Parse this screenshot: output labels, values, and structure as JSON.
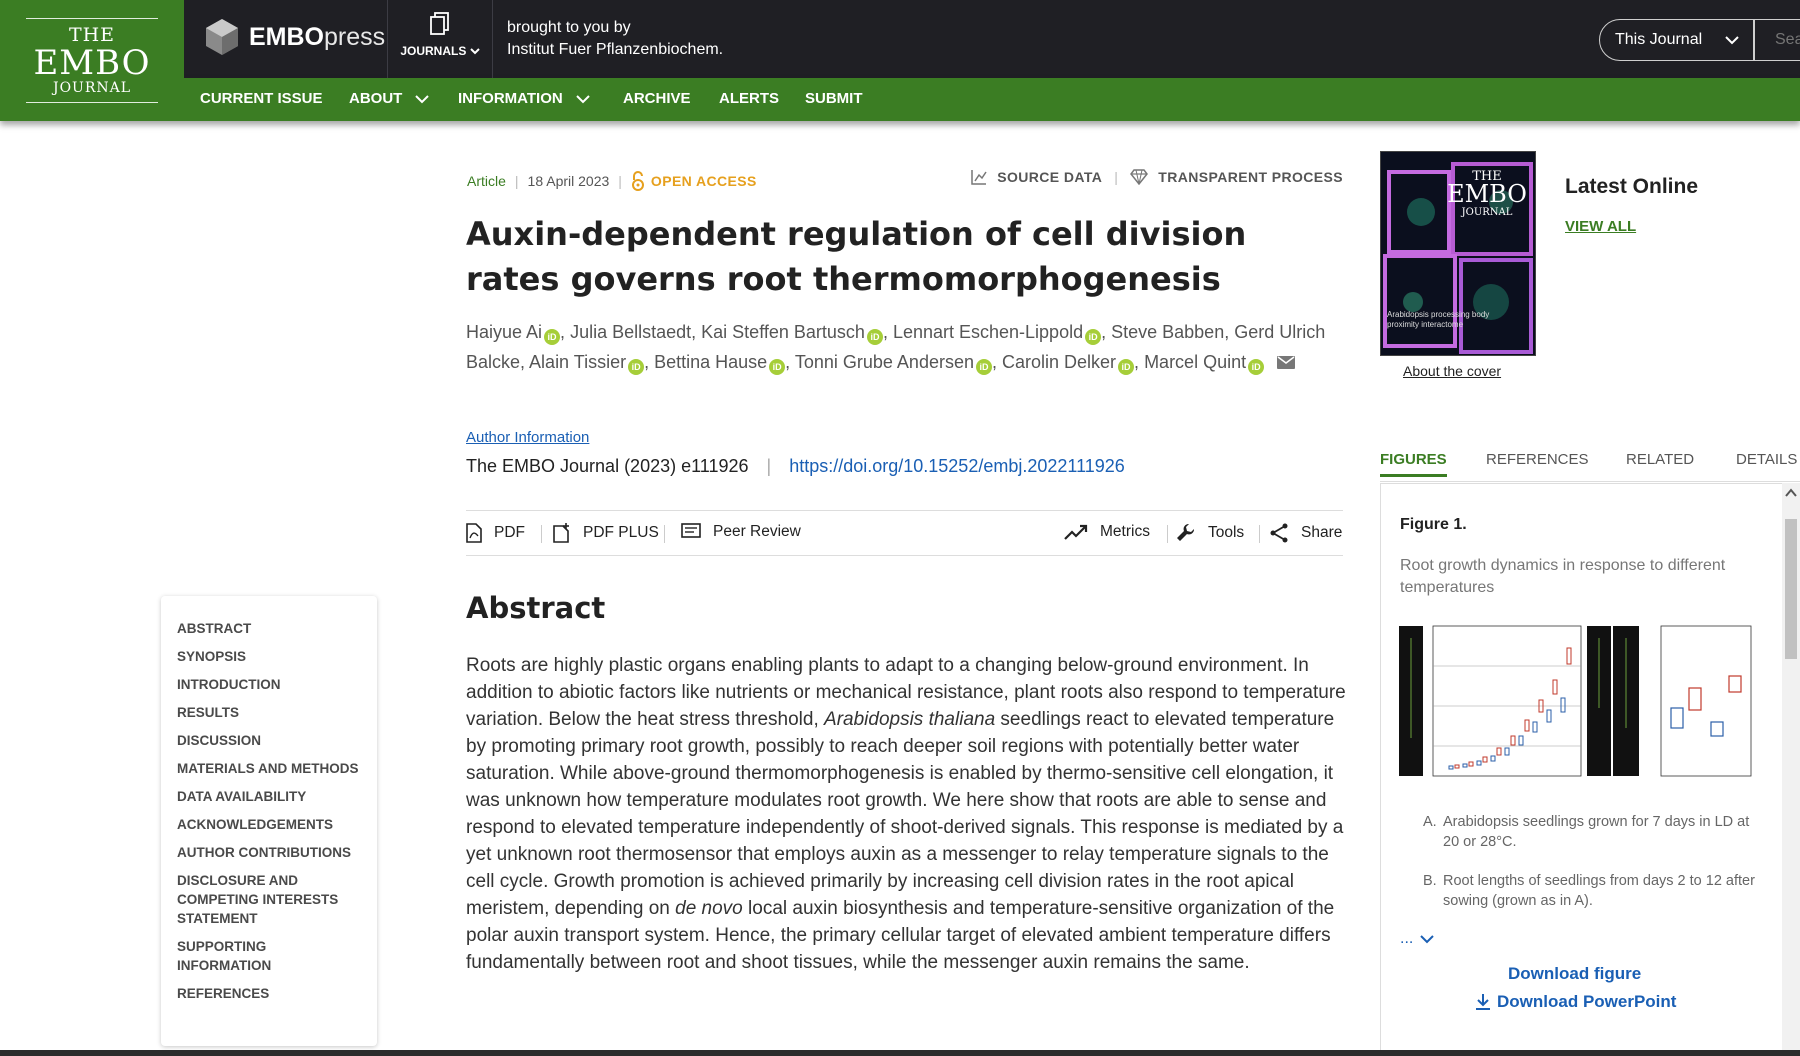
{
  "header": {
    "logo": {
      "line1": "THE",
      "line2": "EMBO",
      "line3": "JOURNAL"
    },
    "embopress": {
      "bold": "EMBO",
      "light": "press"
    },
    "journals_label": "JOURNALS",
    "brought_line1": "brought to you by",
    "brought_line2": "Institut Fuer Pflanzenbiochem.",
    "journal_select": "This Journal",
    "search_placeholder": "Sea"
  },
  "nav": {
    "items": [
      "CURRENT ISSUE",
      "ABOUT",
      "INFORMATION",
      "ARCHIVE",
      "ALERTS",
      "SUBMIT"
    ]
  },
  "toc": {
    "items": [
      "ABSTRACT",
      "SYNOPSIS",
      "INTRODUCTION",
      "RESULTS",
      "DISCUSSION",
      "MATERIALS AND METHODS",
      "DATA AVAILABILITY",
      "ACKNOWLEDGEMENTS",
      "AUTHOR CONTRIBUTIONS",
      "DISCLOSURE AND COMPETING INTERESTS STATEMENT",
      "SUPPORTING INFORMATION",
      "REFERENCES"
    ]
  },
  "article": {
    "type": "Article",
    "date": "18 April 2023",
    "open_access": "OPEN ACCESS",
    "source_data": "SOURCE DATA",
    "transparent_process": "TRANSPARENT PROCESS",
    "title": "Auxin-dependent regulation of cell division rates governs root thermomorphogenesis",
    "authors": {
      "a1": "Haiyue Ai",
      "a2": "Julia Bellstaedt",
      "a3": "Kai Steffen Bartusch",
      "a4": "Lennart Eschen-Lippold",
      "a5": "Steve Babben",
      "a6": "Gerd Ulrich Balcke",
      "a7": "Alain Tissier",
      "a8": "Bettina Hause",
      "a9": "Tonni Grube Andersen",
      "a10": "Carolin Delker",
      "a11": "Marcel Quint"
    },
    "author_information": "Author Information",
    "citation": "The EMBO Journal (2023) e111926",
    "doi": "https://doi.org/10.15252/embj.2022111926"
  },
  "toolbar": {
    "pdf": "PDF",
    "pdf_plus": "PDF PLUS",
    "peer_review": "Peer Review",
    "metrics": "Metrics",
    "tools": "Tools",
    "share": "Share"
  },
  "abstract": {
    "heading": "Abstract",
    "p1": "Roots are highly plastic organs enabling plants to adapt to a changing below-ground environment. In addition to abiotic factors like nutrients or mechanical resistance, plant roots also respond to temperature variation. Below the heat stress threshold, ",
    "p1_italic": "Arabidopsis thaliana",
    "p2": " seedlings react to elevated temperature by promoting primary root growth, possibly to reach deeper soil regions with potentially better water saturation. While above-ground thermomorphogenesis is enabled by thermo-sensitive cell elongation, it was unknown how temperature modulates root growth. We here show that roots are able to sense and respond to elevated temperature independently of shoot-derived signals. This response is mediated by a yet unknown root thermosensor that employs auxin as a messenger to relay temperature signals to the cell cycle. Growth promotion is achieved primarily by increasing cell division rates in the root apical meristem, depending on ",
    "p2_italic": "de novo",
    "p3": " local auxin biosynthesis and temperature-sensitive organization of the polar auxin transport system. Hence, the primary cellular target of elevated ambient temperature differs fundamentally between root and shoot tissues, while the messenger auxin remains the same."
  },
  "sidebar": {
    "cover_title_1": "THE",
    "cover_title_2": "EMBO",
    "cover_title_3": "JOURNAL",
    "cover_text": "Arabidopsis processing body proximity interactome",
    "about_cover": "About the cover",
    "latest_online": "Latest Online",
    "view_all": "VIEW ALL",
    "tabs": [
      "FIGURES",
      "REFERENCES",
      "RELATED",
      "DETAILS"
    ],
    "active_tab": "FIGURES",
    "figure_title": "Figure 1.",
    "figure_desc": "Root growth dynamics in response to different temperatures",
    "legend": [
      {
        "key": "A.",
        "text": "Arabidopsis seedlings grown for 7 days in LD at 20 or 28°C."
      },
      {
        "key": "B.",
        "text": "Root lengths of seedlings from days 2 to 12 after sowing (grown as in A)."
      }
    ],
    "more": "...",
    "download_figure": "Download figure",
    "download_ppt": "Download PowerPoint"
  },
  "colors": {
    "brand_green": "#3b7d23",
    "header_dark": "#1f1f24",
    "open_access": "#e6a01e",
    "link_blue": "#1a5fb4"
  }
}
